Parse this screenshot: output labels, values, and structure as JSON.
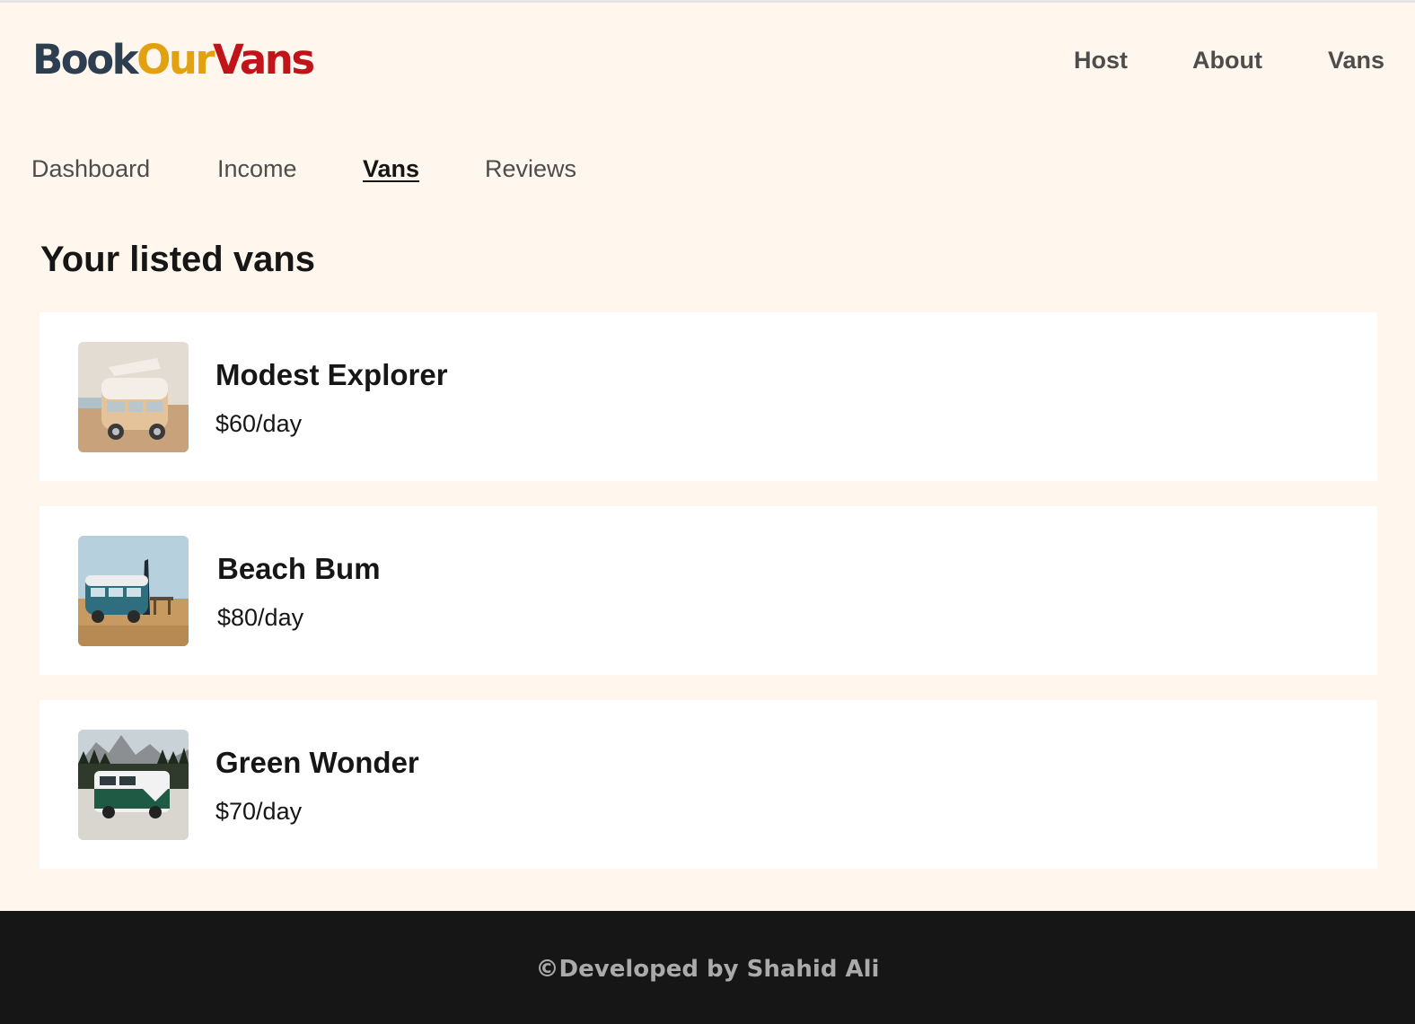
{
  "header": {
    "logo": {
      "part1": "Book",
      "part2": "Our",
      "part3": "Vans"
    },
    "nav": [
      {
        "label": "Host"
      },
      {
        "label": "About"
      },
      {
        "label": "Vans"
      }
    ]
  },
  "host_nav": {
    "items": [
      {
        "label": "Dashboard",
        "active": false
      },
      {
        "label": "Income",
        "active": false
      },
      {
        "label": "Vans",
        "active": true
      },
      {
        "label": "Reviews",
        "active": false
      }
    ]
  },
  "main": {
    "title": "Your listed vans",
    "vans": [
      {
        "name": "Modest Explorer",
        "price": "$60/day",
        "image": "beige-camper-van-photo"
      },
      {
        "name": "Beach Bum",
        "price": "$80/day",
        "image": "teal-van-beach-photo"
      },
      {
        "name": "Green Wonder",
        "price": "$70/day",
        "image": "green-van-mountains-photo"
      }
    ]
  },
  "footer": {
    "text": "©Developed by Shahid Ali"
  },
  "colors": {
    "background": "#FFF7ED",
    "logo_book": "#2D3E50",
    "logo_our": "#E2A110",
    "logo_vans": "#C0131A",
    "footer_bg": "#161616"
  }
}
